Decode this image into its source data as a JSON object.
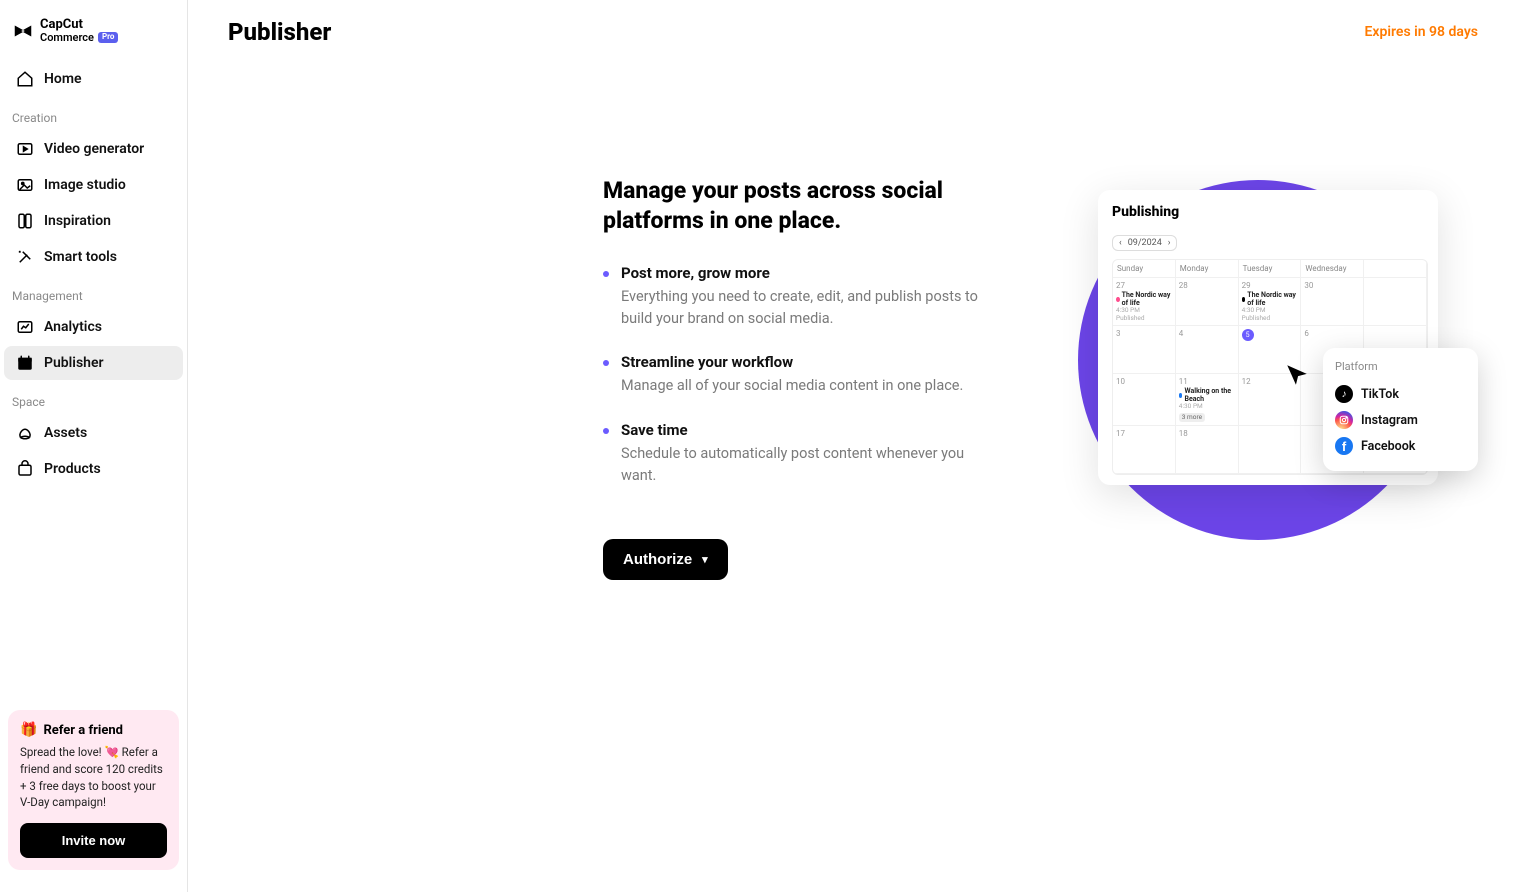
{
  "logo": {
    "line1": "CapCut",
    "line2": "Commerce",
    "badge": "Pro"
  },
  "sidebar": {
    "home": "Home",
    "section_creation": "Creation",
    "video_generator": "Video generator",
    "image_studio": "Image studio",
    "inspiration": "Inspiration",
    "smart_tools": "Smart tools",
    "section_management": "Management",
    "analytics": "Analytics",
    "publisher": "Publisher",
    "section_space": "Space",
    "assets": "Assets",
    "products": "Products"
  },
  "refer": {
    "title": "Refer a friend",
    "text": "Spread the love! 💘 Refer a friend and score 120 credits + 3 free days to boost your V-Day campaign!",
    "invite_label": "Invite now"
  },
  "header": {
    "title": "Publisher",
    "expires": "Expires in 98 days"
  },
  "hero": {
    "title": "Manage your posts across social platforms in one place.",
    "bullets": [
      {
        "title": "Post more, grow more",
        "desc": "Everything you need to create, edit, and publish posts to build your brand on social media."
      },
      {
        "title": "Streamline your workflow",
        "desc": "Manage all of your social media content in one place."
      },
      {
        "title": "Save time",
        "desc": "Schedule to automatically post content whenever you want."
      }
    ],
    "authorize_label": "Authorize"
  },
  "illustration": {
    "calendar_title": "Publishing",
    "month": "09/2024",
    "days": [
      "Sunday",
      "Monday",
      "Tuesday",
      "Wednesday",
      ""
    ],
    "row1_nums": [
      "27",
      "28",
      "29",
      "30",
      ""
    ],
    "row2_nums": [
      "3",
      "4",
      "5",
      "6",
      ""
    ],
    "row3_nums": [
      "10",
      "11",
      "12",
      "",
      ""
    ],
    "row4_nums": [
      "17",
      "18",
      "",
      "",
      ""
    ],
    "event_nordic": "The Nordic way of life",
    "event_time": "4:30 PM",
    "event_status": "Published",
    "event_walking": "Walking on the Beach",
    "more_tag": "3 more",
    "platform_label": "Platform",
    "platforms": {
      "tiktok": "TikTok",
      "instagram": "Instagram",
      "facebook": "Facebook"
    }
  }
}
